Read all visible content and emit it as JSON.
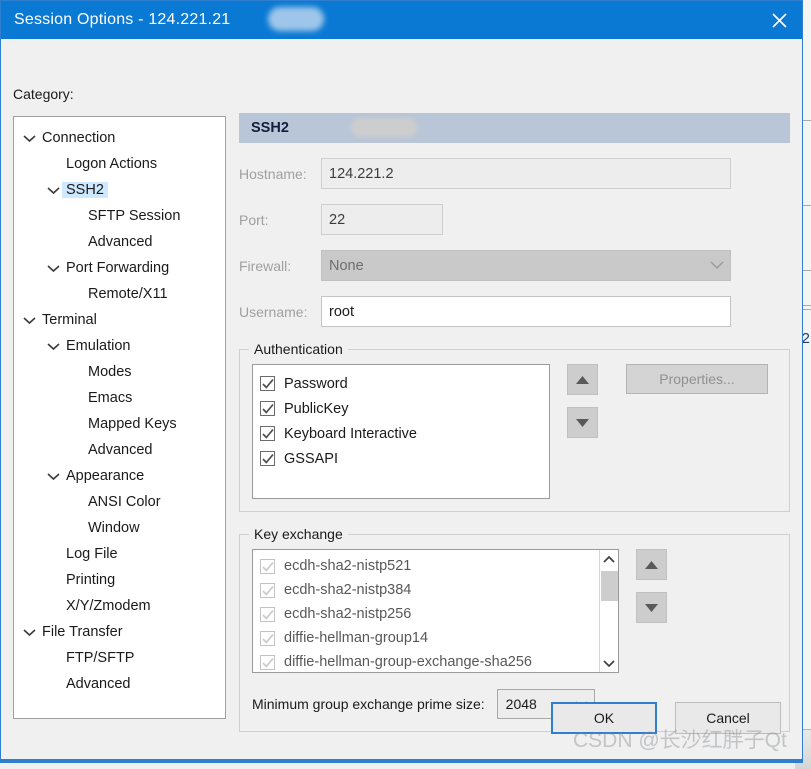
{
  "window": {
    "title": "Session Options - 124.221.21",
    "title_redacted": true,
    "close_icon": "close-icon",
    "titlebar_color": "#0a79d4",
    "border_color": "#2f7fd1"
  },
  "category": {
    "label": "Category:",
    "items": [
      {
        "label": "Connection",
        "indent": 0,
        "expander": "chevron-down",
        "selected": false
      },
      {
        "label": "Logon Actions",
        "indent": 1,
        "expander": "none",
        "selected": false
      },
      {
        "label": "SSH2",
        "indent": 1,
        "expander": "chevron-down",
        "selected": true
      },
      {
        "label": "SFTP Session",
        "indent": 2,
        "expander": "none",
        "selected": false
      },
      {
        "label": "Advanced",
        "indent": 2,
        "expander": "none",
        "selected": false
      },
      {
        "label": "Port Forwarding",
        "indent": 1,
        "expander": "chevron-down",
        "selected": false
      },
      {
        "label": "Remote/X11",
        "indent": 2,
        "expander": "none",
        "selected": false
      },
      {
        "label": "Terminal",
        "indent": 0,
        "expander": "chevron-down",
        "selected": false
      },
      {
        "label": "Emulation",
        "indent": 1,
        "expander": "chevron-down",
        "selected": false
      },
      {
        "label": "Modes",
        "indent": 2,
        "expander": "none",
        "selected": false
      },
      {
        "label": "Emacs",
        "indent": 2,
        "expander": "none",
        "selected": false
      },
      {
        "label": "Mapped Keys",
        "indent": 2,
        "expander": "none",
        "selected": false
      },
      {
        "label": "Advanced",
        "indent": 2,
        "expander": "none",
        "selected": false
      },
      {
        "label": "Appearance",
        "indent": 1,
        "expander": "chevron-down",
        "selected": false
      },
      {
        "label": "ANSI Color",
        "indent": 2,
        "expander": "none",
        "selected": false
      },
      {
        "label": "Window",
        "indent": 2,
        "expander": "none",
        "selected": false
      },
      {
        "label": "Log File",
        "indent": 1,
        "expander": "none",
        "selected": false
      },
      {
        "label": "Printing",
        "indent": 1,
        "expander": "none",
        "selected": false
      },
      {
        "label": "X/Y/Zmodem",
        "indent": 1,
        "expander": "none",
        "selected": false
      },
      {
        "label": "File Transfer",
        "indent": 0,
        "expander": "chevron-down",
        "selected": false
      },
      {
        "label": "FTP/SFTP",
        "indent": 1,
        "expander": "none",
        "selected": false
      },
      {
        "label": "Advanced",
        "indent": 1,
        "expander": "none",
        "selected": false
      }
    ],
    "selection_color": "#cde8ff"
  },
  "pane": {
    "header": "SSH2",
    "header_bg": "#b9c6d8",
    "fields": {
      "hostname": {
        "label": "Hostname:",
        "value": "124.221.2",
        "redacted": true,
        "disabled": true
      },
      "port": {
        "label": "Port:",
        "value": "22",
        "disabled": true
      },
      "firewall": {
        "label": "Firewall:",
        "value": "None",
        "disabled": true,
        "type": "dropdown"
      },
      "username": {
        "label": "Username:",
        "value": "root",
        "disabled": false
      }
    },
    "authentication": {
      "title": "Authentication",
      "items": [
        {
          "label": "Password",
          "checked": true
        },
        {
          "label": "PublicKey",
          "checked": true
        },
        {
          "label": "Keyboard Interactive",
          "checked": true
        },
        {
          "label": "GSSAPI",
          "checked": true
        }
      ],
      "move_up_icon": "triangle-up-icon",
      "move_down_icon": "triangle-down-icon",
      "properties_button": "Properties...",
      "properties_disabled": true
    },
    "key_exchange": {
      "title": "Key exchange",
      "items": [
        {
          "label": "ecdh-sha2-nistp521",
          "checked": true,
          "dimmed": true
        },
        {
          "label": "ecdh-sha2-nistp384",
          "checked": true,
          "dimmed": true
        },
        {
          "label": "ecdh-sha2-nistp256",
          "checked": true,
          "dimmed": true
        },
        {
          "label": "diffie-hellman-group14",
          "checked": true,
          "dimmed": true
        },
        {
          "label": "diffie-hellman-group-exchange-sha256",
          "checked": true,
          "dimmed": true
        }
      ],
      "scroll_up_icon": "chevron-up-icon",
      "scroll_down_icon": "chevron-down-icon",
      "move_up_icon": "triangle-up-icon",
      "move_down_icon": "triangle-down-icon"
    },
    "prime_size": {
      "label": "Minimum group exchange prime size:",
      "value": "2048",
      "dropdown_icon": "chevron-down-icon"
    }
  },
  "footer": {
    "ok_label": "OK",
    "cancel_label": "Cancel",
    "ok_focused": true
  },
  "watermark": "CSDN @长沙红胖子Qt",
  "background": {
    "digit": "2"
  }
}
